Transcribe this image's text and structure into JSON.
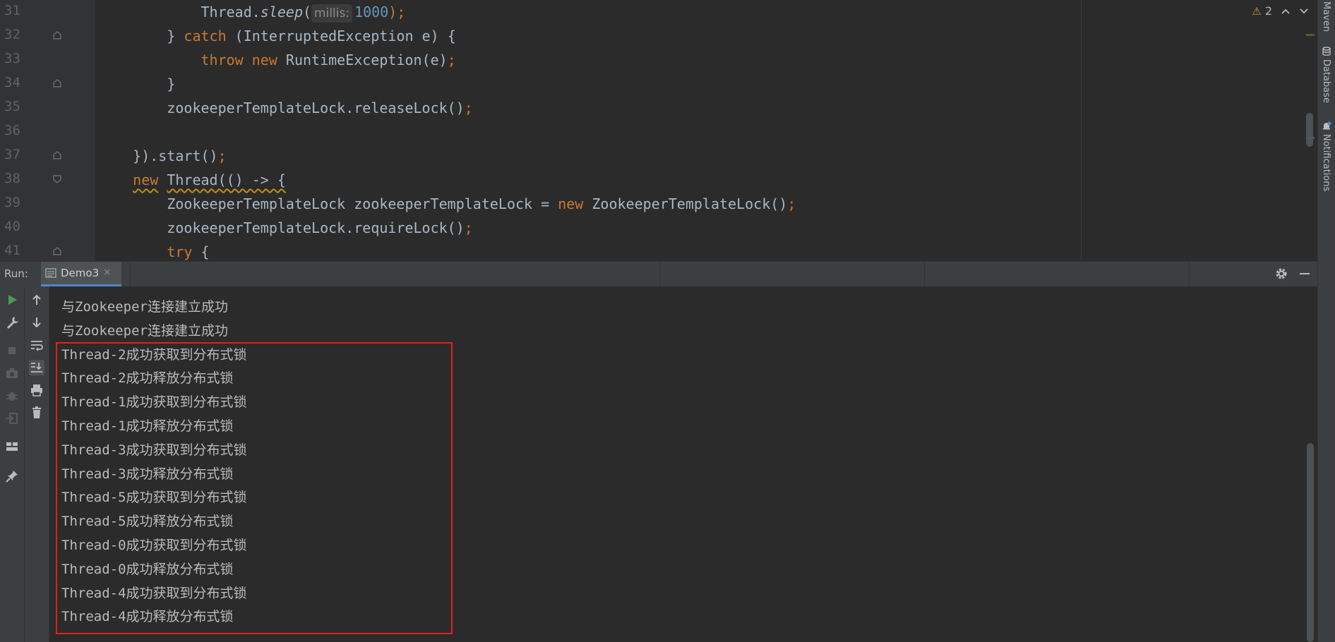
{
  "editor": {
    "lines": [
      {
        "no": "31",
        "tokens": [
          {
            "t": "            Thread.",
            "c": "plain"
          },
          {
            "t": "sleep",
            "c": "plain italic"
          },
          {
            "t": "(",
            "c": "plain"
          },
          {
            "t": "millis:",
            "c": "hint"
          },
          {
            "t": "1000",
            "c": "num"
          },
          {
            "t": ");",
            "c": "kw"
          }
        ]
      },
      {
        "no": "32",
        "tokens": [
          {
            "t": "        } ",
            "c": "plain"
          },
          {
            "t": "catch",
            "c": "kw"
          },
          {
            "t": " (InterruptedException e) {",
            "c": "plain"
          }
        ]
      },
      {
        "no": "33",
        "tokens": [
          {
            "t": "            ",
            "c": "plain"
          },
          {
            "t": "throw new",
            "c": "kw"
          },
          {
            "t": " RuntimeException(e)",
            "c": "plain"
          },
          {
            "t": ";",
            "c": "kw"
          }
        ]
      },
      {
        "no": "34",
        "tokens": [
          {
            "t": "        }",
            "c": "plain"
          }
        ]
      },
      {
        "no": "35",
        "tokens": [
          {
            "t": "        zookeeperTemplateLock.releaseLock()",
            "c": "plain"
          },
          {
            "t": ";",
            "c": "kw"
          }
        ]
      },
      {
        "no": "36",
        "tokens": []
      },
      {
        "no": "37",
        "tokens": [
          {
            "t": "    }).start()",
            "c": "plain"
          },
          {
            "t": ";",
            "c": "kw"
          }
        ]
      },
      {
        "no": "38",
        "tokens": [
          {
            "t": "    ",
            "c": "plain"
          },
          {
            "t": "new",
            "c": "kw squiggle"
          },
          {
            "t": " ",
            "c": "plain"
          },
          {
            "t": "Thread(() -> {",
            "c": "plain squiggle"
          }
        ]
      },
      {
        "no": "39",
        "tokens": [
          {
            "t": "        ZookeeperTemplateLock zookeeperTemplateLock = ",
            "c": "plain"
          },
          {
            "t": "new",
            "c": "kw"
          },
          {
            "t": " ZookeeperTemplateLock()",
            "c": "plain"
          },
          {
            "t": ";",
            "c": "kw"
          }
        ]
      },
      {
        "no": "40",
        "tokens": [
          {
            "t": "        zookeeperTemplateLock.requireLock()",
            "c": "plain"
          },
          {
            "t": ";",
            "c": "kw"
          }
        ]
      },
      {
        "no": "41",
        "tokens": [
          {
            "t": "        ",
            "c": "plain"
          },
          {
            "t": "try",
            "c": "kw"
          },
          {
            "t": " {",
            "c": "plain"
          }
        ]
      }
    ],
    "warning_count": "2"
  },
  "right_strip": {
    "maven_label": "Maven",
    "database_label": "Database",
    "notifications_label": "Notifications"
  },
  "run_panel": {
    "run_label": "Run:",
    "tab_label": "Demo3",
    "tab_close": "×"
  },
  "console": {
    "lines": [
      "与Zookeeper连接建立成功",
      "与Zookeeper连接建立成功",
      "Thread-2成功获取到分布式锁",
      "Thread-2成功释放分布式锁",
      "Thread-1成功获取到分布式锁",
      "Thread-1成功释放分布式锁",
      "Thread-3成功获取到分布式锁",
      "Thread-3成功释放分布式锁",
      "Thread-5成功获取到分布式锁",
      "Thread-5成功释放分布式锁",
      "Thread-0成功获取到分布式锁",
      "Thread-0成功释放分布式锁",
      "Thread-4成功获取到分布式锁",
      "Thread-4成功释放分布式锁"
    ]
  },
  "colors": {
    "keyword": "#cc7832",
    "number": "#6897bb",
    "text": "#a9b7c6",
    "highlight_border": "#e02020",
    "tab_underline": "#4a88c7",
    "run_green": "#499c54"
  }
}
